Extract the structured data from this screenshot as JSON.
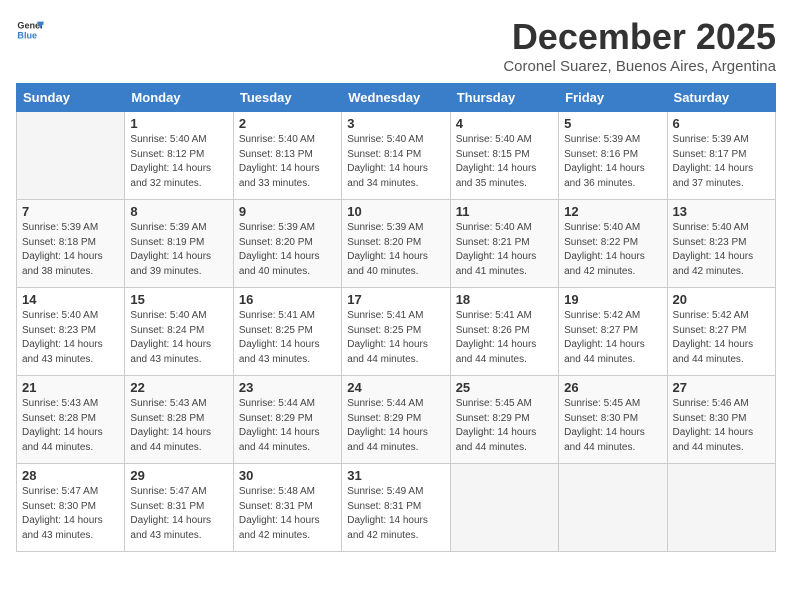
{
  "logo": {
    "general": "General",
    "blue": "Blue"
  },
  "title": "December 2025",
  "location": "Coronel Suarez, Buenos Aires, Argentina",
  "weekdays": [
    "Sunday",
    "Monday",
    "Tuesday",
    "Wednesday",
    "Thursday",
    "Friday",
    "Saturday"
  ],
  "weeks": [
    [
      {
        "day": "",
        "info": ""
      },
      {
        "day": "1",
        "info": "Sunrise: 5:40 AM\nSunset: 8:12 PM\nDaylight: 14 hours\nand 32 minutes."
      },
      {
        "day": "2",
        "info": "Sunrise: 5:40 AM\nSunset: 8:13 PM\nDaylight: 14 hours\nand 33 minutes."
      },
      {
        "day": "3",
        "info": "Sunrise: 5:40 AM\nSunset: 8:14 PM\nDaylight: 14 hours\nand 34 minutes."
      },
      {
        "day": "4",
        "info": "Sunrise: 5:40 AM\nSunset: 8:15 PM\nDaylight: 14 hours\nand 35 minutes."
      },
      {
        "day": "5",
        "info": "Sunrise: 5:39 AM\nSunset: 8:16 PM\nDaylight: 14 hours\nand 36 minutes."
      },
      {
        "day": "6",
        "info": "Sunrise: 5:39 AM\nSunset: 8:17 PM\nDaylight: 14 hours\nand 37 minutes."
      }
    ],
    [
      {
        "day": "7",
        "info": "Sunrise: 5:39 AM\nSunset: 8:18 PM\nDaylight: 14 hours\nand 38 minutes."
      },
      {
        "day": "8",
        "info": "Sunrise: 5:39 AM\nSunset: 8:19 PM\nDaylight: 14 hours\nand 39 minutes."
      },
      {
        "day": "9",
        "info": "Sunrise: 5:39 AM\nSunset: 8:20 PM\nDaylight: 14 hours\nand 40 minutes."
      },
      {
        "day": "10",
        "info": "Sunrise: 5:39 AM\nSunset: 8:20 PM\nDaylight: 14 hours\nand 40 minutes."
      },
      {
        "day": "11",
        "info": "Sunrise: 5:40 AM\nSunset: 8:21 PM\nDaylight: 14 hours\nand 41 minutes."
      },
      {
        "day": "12",
        "info": "Sunrise: 5:40 AM\nSunset: 8:22 PM\nDaylight: 14 hours\nand 42 minutes."
      },
      {
        "day": "13",
        "info": "Sunrise: 5:40 AM\nSunset: 8:23 PM\nDaylight: 14 hours\nand 42 minutes."
      }
    ],
    [
      {
        "day": "14",
        "info": "Sunrise: 5:40 AM\nSunset: 8:23 PM\nDaylight: 14 hours\nand 43 minutes."
      },
      {
        "day": "15",
        "info": "Sunrise: 5:40 AM\nSunset: 8:24 PM\nDaylight: 14 hours\nand 43 minutes."
      },
      {
        "day": "16",
        "info": "Sunrise: 5:41 AM\nSunset: 8:25 PM\nDaylight: 14 hours\nand 43 minutes."
      },
      {
        "day": "17",
        "info": "Sunrise: 5:41 AM\nSunset: 8:25 PM\nDaylight: 14 hours\nand 44 minutes."
      },
      {
        "day": "18",
        "info": "Sunrise: 5:41 AM\nSunset: 8:26 PM\nDaylight: 14 hours\nand 44 minutes."
      },
      {
        "day": "19",
        "info": "Sunrise: 5:42 AM\nSunset: 8:27 PM\nDaylight: 14 hours\nand 44 minutes."
      },
      {
        "day": "20",
        "info": "Sunrise: 5:42 AM\nSunset: 8:27 PM\nDaylight: 14 hours\nand 44 minutes."
      }
    ],
    [
      {
        "day": "21",
        "info": "Sunrise: 5:43 AM\nSunset: 8:28 PM\nDaylight: 14 hours\nand 44 minutes."
      },
      {
        "day": "22",
        "info": "Sunrise: 5:43 AM\nSunset: 8:28 PM\nDaylight: 14 hours\nand 44 minutes."
      },
      {
        "day": "23",
        "info": "Sunrise: 5:44 AM\nSunset: 8:29 PM\nDaylight: 14 hours\nand 44 minutes."
      },
      {
        "day": "24",
        "info": "Sunrise: 5:44 AM\nSunset: 8:29 PM\nDaylight: 14 hours\nand 44 minutes."
      },
      {
        "day": "25",
        "info": "Sunrise: 5:45 AM\nSunset: 8:29 PM\nDaylight: 14 hours\nand 44 minutes."
      },
      {
        "day": "26",
        "info": "Sunrise: 5:45 AM\nSunset: 8:30 PM\nDaylight: 14 hours\nand 44 minutes."
      },
      {
        "day": "27",
        "info": "Sunrise: 5:46 AM\nSunset: 8:30 PM\nDaylight: 14 hours\nand 44 minutes."
      }
    ],
    [
      {
        "day": "28",
        "info": "Sunrise: 5:47 AM\nSunset: 8:30 PM\nDaylight: 14 hours\nand 43 minutes."
      },
      {
        "day": "29",
        "info": "Sunrise: 5:47 AM\nSunset: 8:31 PM\nDaylight: 14 hours\nand 43 minutes."
      },
      {
        "day": "30",
        "info": "Sunrise: 5:48 AM\nSunset: 8:31 PM\nDaylight: 14 hours\nand 42 minutes."
      },
      {
        "day": "31",
        "info": "Sunrise: 5:49 AM\nSunset: 8:31 PM\nDaylight: 14 hours\nand 42 minutes."
      },
      {
        "day": "",
        "info": ""
      },
      {
        "day": "",
        "info": ""
      },
      {
        "day": "",
        "info": ""
      }
    ]
  ]
}
